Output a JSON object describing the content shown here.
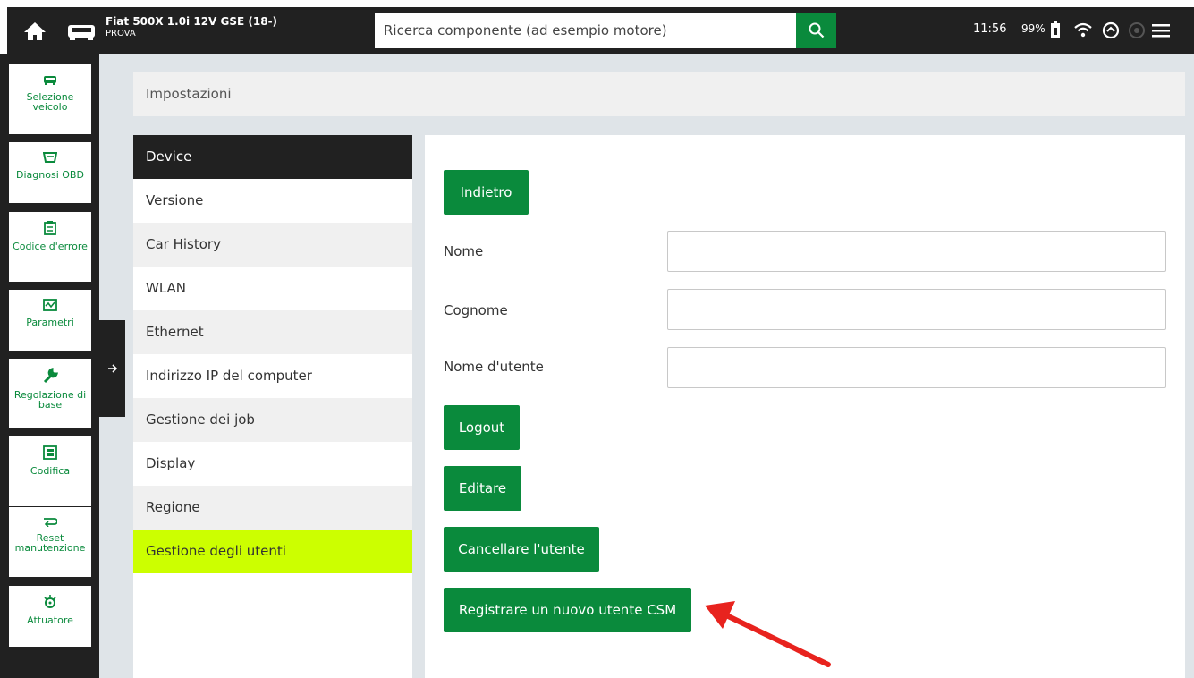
{
  "header": {
    "vehicle_name": "Fiat 500X 1.0i 12V GSE (18-)",
    "vehicle_sub": "PROVA",
    "search_placeholder": "Ricerca componente (ad esempio motore)",
    "time": "11:56",
    "battery": "99%",
    "icons": [
      "home-icon",
      "car-icon",
      "search-icon",
      "battery-icon",
      "wifi-icon",
      "sync-icon",
      "vci-icon",
      "menu-icon"
    ]
  },
  "sidebar": {
    "items": [
      {
        "label": "Selezione veicolo",
        "icon": "car-icon"
      },
      {
        "label": "Diagnosi OBD",
        "icon": "obd-icon"
      },
      {
        "label": "Codice d'errore",
        "icon": "error-code-icon"
      },
      {
        "label": "Parametri",
        "icon": "parameters-icon"
      },
      {
        "label": "Regolazione di base",
        "icon": "wrench-icon"
      },
      {
        "label": "Codifica",
        "icon": "coding-icon"
      },
      {
        "label": "Reset manutenzione",
        "icon": "service-reset-icon"
      },
      {
        "label": "Attuatore",
        "icon": "actuator-icon"
      }
    ],
    "toggle_icon": "arrow-right-icon"
  },
  "breadcrumb": "Impostazioni",
  "menu": {
    "items": [
      "Device",
      "Versione",
      "Car History",
      "WLAN",
      "Ethernet",
      "Indirizzo IP del computer",
      "Gestione dei job",
      "Display",
      "Regione",
      "Gestione degli utenti"
    ],
    "active": "Device",
    "selected": "Gestione degli utenti"
  },
  "panel": {
    "back_button": "Indietro",
    "fields": [
      {
        "label": "Nome",
        "value": ""
      },
      {
        "label": "Cognome",
        "value": ""
      },
      {
        "label": "Nome d'utente",
        "value": ""
      }
    ],
    "buttons": {
      "logout": "Logout",
      "edit": "Editare",
      "delete_user": "Cancellare l'utente",
      "register_csm": "Registrare un nuovo utente CSM"
    }
  },
  "colors": {
    "accent_green": "#0a8a3c",
    "highlight_yellow": "#ccff00",
    "dark": "#212121",
    "annotation_arrow": "#e8231e"
  }
}
